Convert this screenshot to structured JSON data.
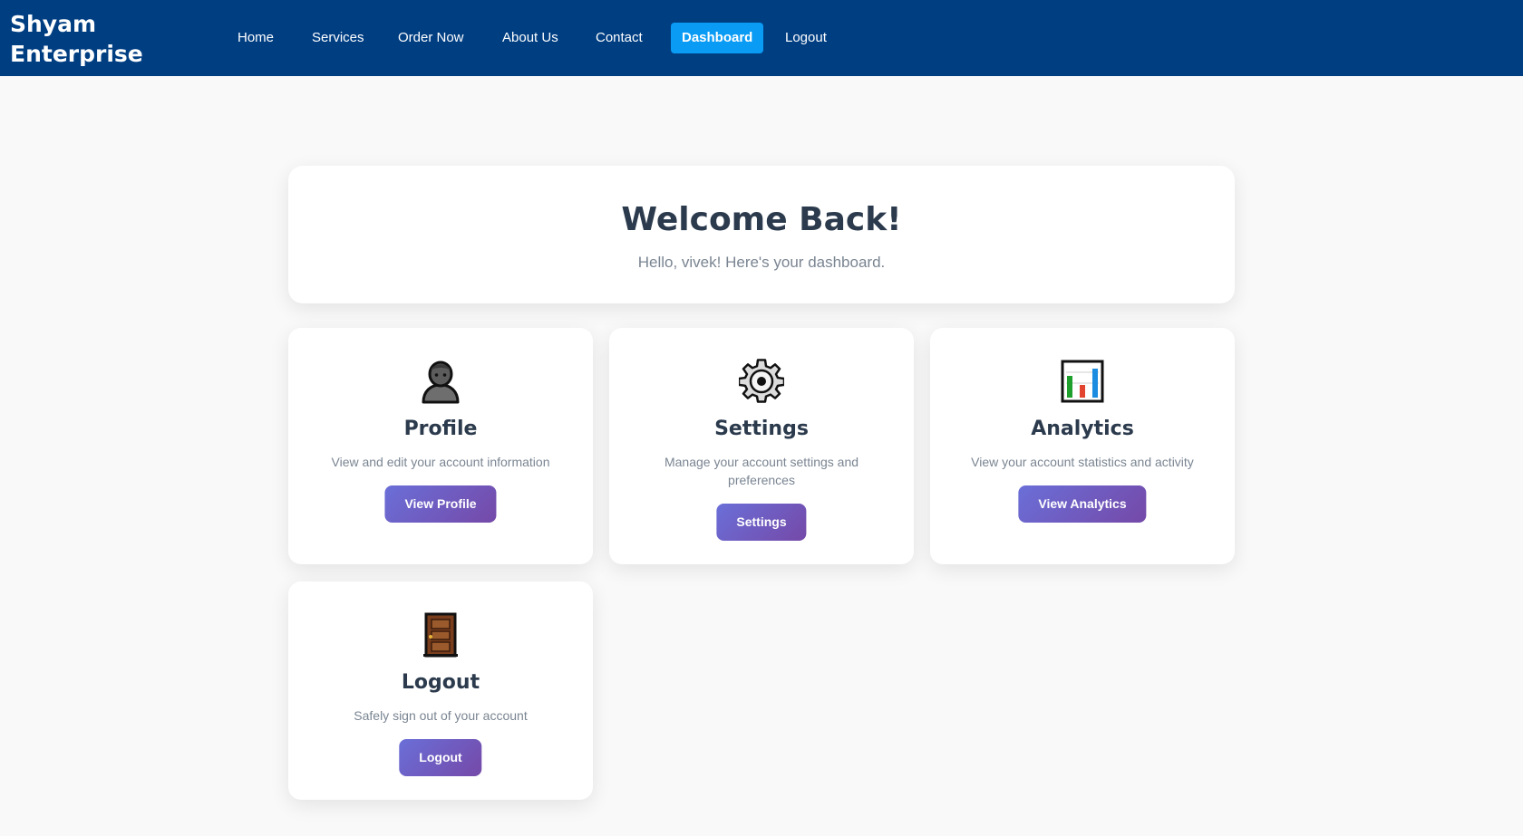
{
  "header": {
    "brand": "Shyam Enterprise",
    "nav": [
      {
        "label": "Home"
      },
      {
        "label": "Services"
      },
      {
        "label": "Order Now"
      },
      {
        "label": "About Us"
      },
      {
        "label": "Contact"
      },
      {
        "label": "Dashboard",
        "active": true
      },
      {
        "label": "Logout"
      }
    ]
  },
  "welcome": {
    "title": "Welcome Back!",
    "subtitle": "Hello, vivek! Here's your dashboard."
  },
  "cards": [
    {
      "icon": "user-silhouette-icon",
      "title": "Profile",
      "description": "View and edit your account information",
      "button": "View Profile"
    },
    {
      "icon": "gear-icon",
      "title": "Settings",
      "description": "Manage your account settings and preferences",
      "button": "Settings"
    },
    {
      "icon": "bar-chart-icon",
      "title": "Analytics",
      "description": "View your account statistics and activity",
      "button": "View Analytics"
    },
    {
      "icon": "door-icon",
      "title": "Logout",
      "description": "Safely sign out of your account",
      "button": "Logout"
    }
  ],
  "colors": {
    "nav_background": "#003e82",
    "nav_active": "#0a9bf4",
    "button_gradient_start": "#6a6fd8",
    "button_gradient_end": "#7549a8",
    "heading_text": "#2b3a4c",
    "muted_text": "#7a8592",
    "page_background": "#f9f9f9"
  }
}
